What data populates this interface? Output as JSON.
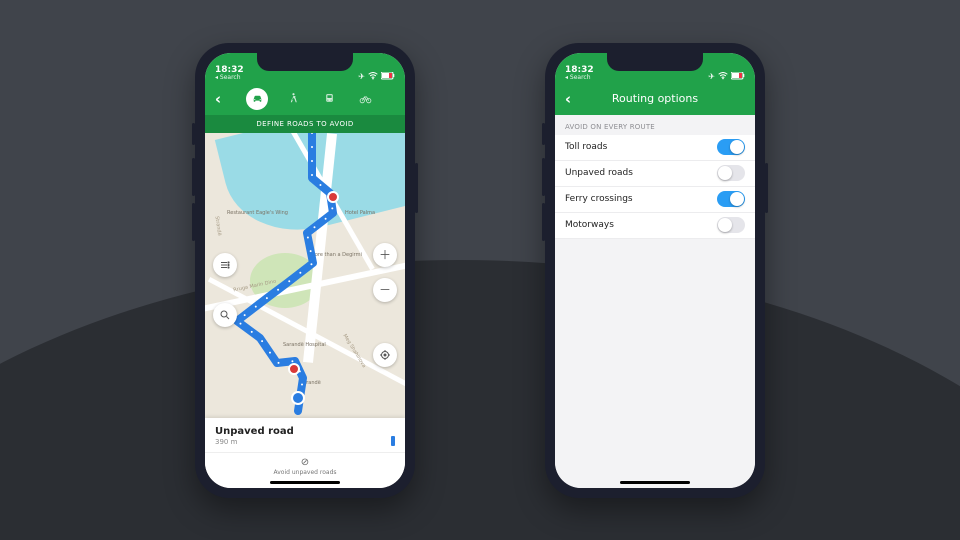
{
  "status": {
    "time": "18:32",
    "back_label": "Search",
    "right_icons": [
      "airplane-icon",
      "wifi-icon",
      "battery-icon"
    ]
  },
  "colors": {
    "accent": "#21a24a",
    "route": "#2a7de1",
    "toggle_on": "#2a9df4"
  },
  "left": {
    "modes": [
      {
        "name": "car",
        "on": true
      },
      {
        "name": "walk",
        "on": false
      },
      {
        "name": "transit",
        "on": false
      },
      {
        "name": "bike",
        "on": false
      }
    ],
    "banner": "DEFINE ROADS TO AVOID",
    "map_labels": {
      "poi_restaurant": "Restaurant\nEagle's Wing",
      "poi_hotel": "Hotel Palma",
      "poi_hospital": "Sarandë\nHospital",
      "poi_city": "Sarandë",
      "poi_text": "more\nthan a Degirmi",
      "road_1": "Rruga Marin Dino",
      "road_2": "Meg Shahinova",
      "road_3": "Strandë"
    },
    "sheet": {
      "title": "Unpaved road",
      "distance": "390 m"
    },
    "footer": {
      "label": "Avoid unpaved roads"
    }
  },
  "right": {
    "title": "Routing options",
    "section": "AVOID ON EVERY ROUTE",
    "rows": [
      {
        "label": "Toll roads",
        "on": true
      },
      {
        "label": "Unpaved roads",
        "on": false
      },
      {
        "label": "Ferry crossings",
        "on": true
      },
      {
        "label": "Motorways",
        "on": false
      }
    ]
  }
}
